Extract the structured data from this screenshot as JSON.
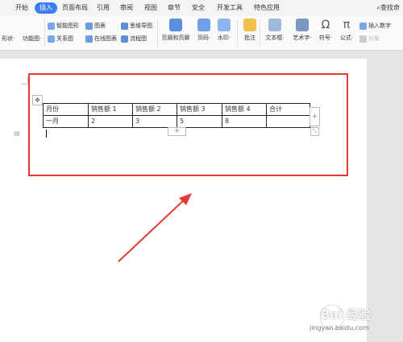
{
  "tabs": [
    "开始",
    "插入",
    "页面布局",
    "引用",
    "审阅",
    "视图",
    "章节",
    "安全",
    "开发工具",
    "特色应用"
  ],
  "active_tab": "插入",
  "search_label": "查找命",
  "ribbon": {
    "shape_label": "形状·",
    "function_chart_label": "功能图·",
    "smart_shape": "智能图形",
    "chart": "图表",
    "mind_map": "思维导图",
    "relation_map": "关系图",
    "online_chart": "在线图表",
    "flowchart": "流程图",
    "header_footer": "页眉和页脚",
    "page_number": "页码·",
    "watermark": "水印·",
    "comment": "批注",
    "textbox": "文本框·",
    "art_text": "艺术字·",
    "symbol": "符号·",
    "formula": "公式·",
    "insert_number": "插入数字",
    "object_faded": "对象·"
  },
  "table": {
    "headers": [
      "月份",
      "销售额 1",
      "销售额 2",
      "销售额 3",
      "销售额 4",
      "合计"
    ],
    "row": [
      "一月",
      "2",
      "3",
      "5",
      "8",
      ""
    ]
  },
  "controls": {
    "add_col": "+",
    "add_row": "+",
    "move": "✥",
    "resize": "⤡"
  },
  "watermark": {
    "text": "Bai 经验",
    "url": "jingyan.baidu.com"
  },
  "colors": {
    "accent": "#3b7cf0",
    "highlight": "#e53935"
  }
}
